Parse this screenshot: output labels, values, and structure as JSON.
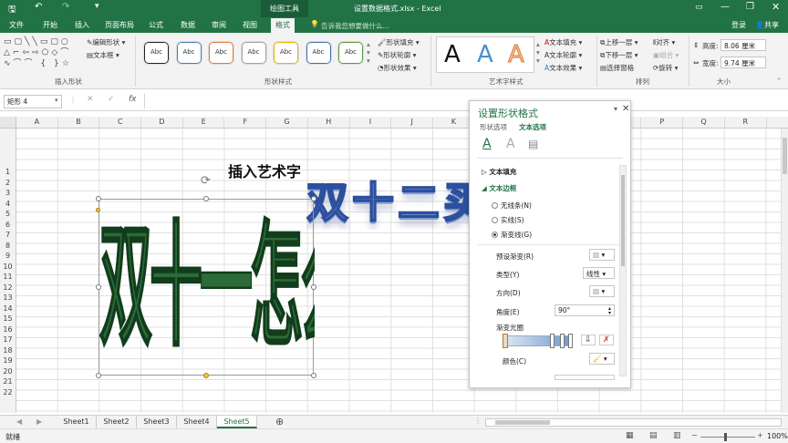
{
  "title": {
    "tools_label": "绘图工具",
    "filename": "设置数据格式.xlsx - Excel"
  },
  "tabs": [
    "文件",
    "开始",
    "插入",
    "页面布局",
    "公式",
    "数据",
    "审阅",
    "视图",
    "格式"
  ],
  "tell_me": "告诉我您想要做什么...",
  "account": {
    "login": "登录",
    "share": "共享"
  },
  "ribbon": {
    "insert_shapes": {
      "edit_shape": "编辑形状",
      "text_box": "文本框",
      "label": "插入形状"
    },
    "shape_styles": {
      "style_sample": "Abc",
      "label": "形状样式",
      "fill": "形状填充",
      "outline": "形状轮廓",
      "effects": "形状效果",
      "colors": [
        "#222222",
        "#4a7ebb",
        "#e07b39",
        "#a0a0a0",
        "#e6b800",
        "#3f6fb0",
        "#5a9a3c"
      ]
    },
    "wordart": {
      "sample": "A",
      "label": "艺术字样式",
      "fill": "文本填充",
      "outline": "文本轮廓",
      "effects": "文本效果"
    },
    "arrange": {
      "forward": "上移一层",
      "backward": "下移一层",
      "pane": "选择窗格",
      "align": "对齐",
      "group": "组合",
      "rotate": "旋转",
      "label": "排列"
    },
    "size": {
      "height_label": "高度:",
      "height_value": "8.06 厘米",
      "width_label": "宽度:",
      "width_value": "9.74 厘米",
      "label": "大小"
    }
  },
  "name_box": "矩形 4",
  "fx": "fx",
  "columns": [
    "A",
    "B",
    "C",
    "D",
    "E",
    "F",
    "G",
    "H",
    "I",
    "J",
    "K",
    "L",
    "M",
    "N",
    "O",
    "P",
    "Q",
    "R"
  ],
  "rows": [
    "1",
    "2",
    "3",
    "4",
    "5",
    "6",
    "7",
    "8",
    "9",
    "10",
    "11",
    "12",
    "13",
    "14",
    "15",
    "16",
    "17",
    "18",
    "19",
    "20",
    "21",
    "22"
  ],
  "sheet_content": {
    "heading": "插入艺术字",
    "vertical_wordart": "双十一怎么过?",
    "wordart_3d": "双十二买"
  },
  "pane": {
    "title": "设置形状格式",
    "tab_shape": "形状选项",
    "tab_text": "文本选项",
    "text_fill": "文本填充",
    "text_border": "文本边框",
    "no_line": "无线条(N)",
    "solid_line": "实线(S)",
    "gradient_line": "渐变线(G)",
    "preset": "预设渐变(R)",
    "type": "类型(Y)",
    "type_value": "线性",
    "direction": "方向(D)",
    "angle": "角度(E)",
    "angle_value": "90°",
    "stops": "渐变光圈",
    "color": "颜色(C)"
  },
  "sheets": [
    "Sheet1",
    "Sheet2",
    "Sheet3",
    "Sheet4",
    "Sheet5"
  ],
  "active_sheet": "Sheet5",
  "status": {
    "ready": "就绪",
    "zoom": "100%"
  }
}
